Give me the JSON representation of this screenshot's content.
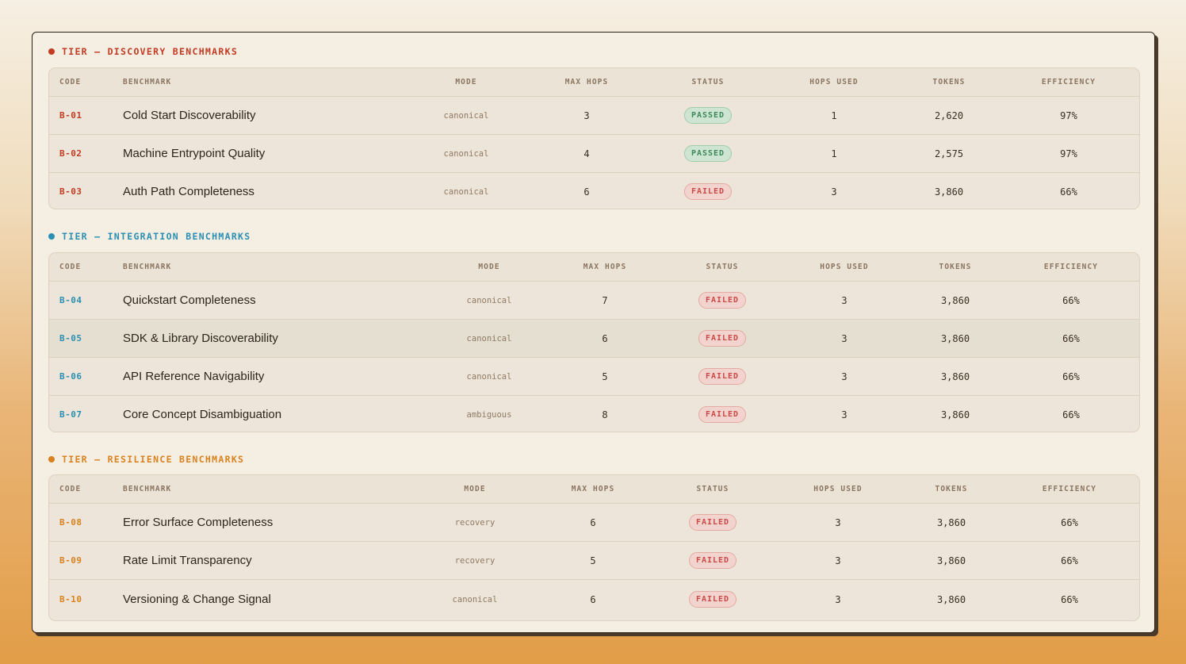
{
  "colors": {
    "discovery": "#c23b22",
    "integration": "#2a8fb3",
    "resilience": "#d9821e",
    "passed": "#3c8a57",
    "failed": "#c94a46"
  },
  "tiers": [
    {
      "title": "TIER — DISCOVERY BENCHMARKS",
      "headers": [
        "CODE",
        "BENCHMARK",
        "MODE",
        "MAX HOPS",
        "STATUS",
        "HOPS USED",
        "TOKENS",
        "EFFICIENCY"
      ],
      "rows": [
        {
          "code": "B-01",
          "benchmark": "Cold Start Discoverability",
          "mode": "canonical",
          "max_hops": "3",
          "status": "PASSED",
          "hops_used": "1",
          "tokens": "2,620",
          "efficiency": "97%"
        },
        {
          "code": "B-02",
          "benchmark": "Machine Entrypoint Quality",
          "mode": "canonical",
          "max_hops": "4",
          "status": "PASSED",
          "hops_used": "1",
          "tokens": "2,575",
          "efficiency": "97%"
        },
        {
          "code": "B-03",
          "benchmark": "Auth Path Completeness",
          "mode": "canonical",
          "max_hops": "6",
          "status": "FAILED",
          "hops_used": "3",
          "tokens": "3,860",
          "efficiency": "66%"
        }
      ]
    },
    {
      "title": "TIER — INTEGRATION BENCHMARKS",
      "headers": [
        "CODE",
        "BENCHMARK",
        "MODE",
        "MAX HOPS",
        "STATUS",
        "HOPS USED",
        "TOKENS",
        "EFFICIENCY"
      ],
      "rows": [
        {
          "code": "B-04",
          "benchmark": "Quickstart Completeness",
          "mode": "canonical",
          "max_hops": "7",
          "status": "FAILED",
          "hops_used": "3",
          "tokens": "3,860",
          "efficiency": "66%"
        },
        {
          "code": "B-05",
          "benchmark": "SDK & Library Discoverability",
          "mode": "canonical",
          "max_hops": "6",
          "status": "FAILED",
          "hops_used": "3",
          "tokens": "3,860",
          "efficiency": "66%"
        },
        {
          "code": "B-06",
          "benchmark": "API Reference Navigability",
          "mode": "canonical",
          "max_hops": "5",
          "status": "FAILED",
          "hops_used": "3",
          "tokens": "3,860",
          "efficiency": "66%"
        },
        {
          "code": "B-07",
          "benchmark": "Core Concept Disambiguation",
          "mode": "ambiguous",
          "max_hops": "8",
          "status": "FAILED",
          "hops_used": "3",
          "tokens": "3,860",
          "efficiency": "66%"
        }
      ]
    },
    {
      "title": "TIER — RESILIENCE BENCHMARKS",
      "headers": [
        "CODE",
        "BENCHMARK",
        "MODE",
        "MAX HOPS",
        "STATUS",
        "HOPS USED",
        "TOKENS",
        "EFFICIENCY"
      ],
      "rows": [
        {
          "code": "B-08",
          "benchmark": "Error Surface Completeness",
          "mode": "recovery",
          "max_hops": "6",
          "status": "FAILED",
          "hops_used": "3",
          "tokens": "3,860",
          "efficiency": "66%"
        },
        {
          "code": "B-09",
          "benchmark": "Rate Limit Transparency",
          "mode": "recovery",
          "max_hops": "5",
          "status": "FAILED",
          "hops_used": "3",
          "tokens": "3,860",
          "efficiency": "66%"
        },
        {
          "code": "B-10",
          "benchmark": "Versioning & Change Signal",
          "mode": "canonical",
          "max_hops": "6",
          "status": "FAILED",
          "hops_used": "3",
          "tokens": "3,860",
          "efficiency": "66%"
        }
      ]
    }
  ]
}
